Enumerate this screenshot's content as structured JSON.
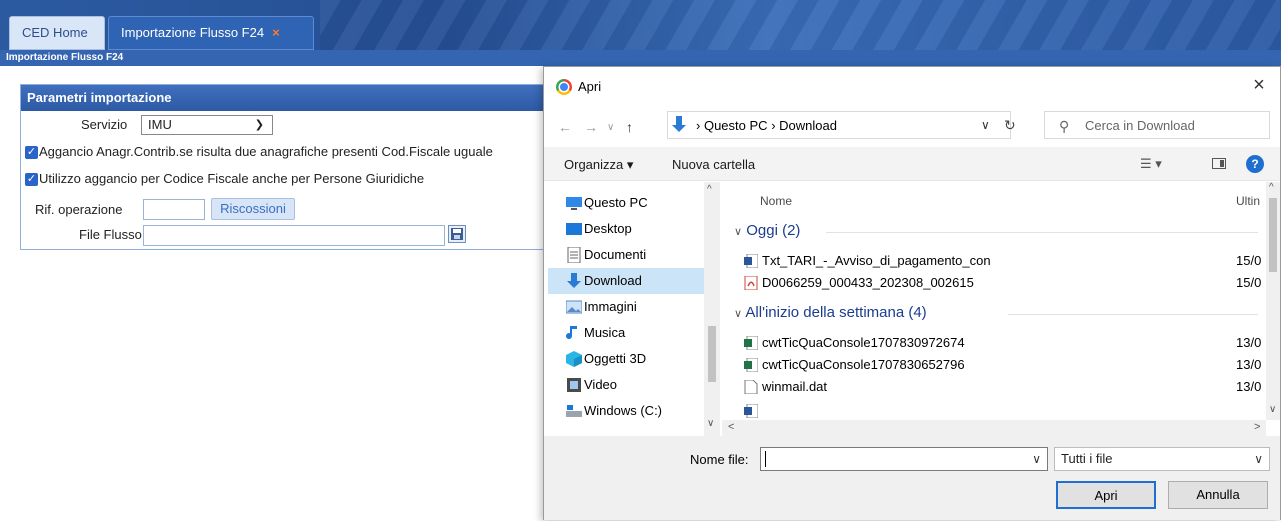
{
  "app": {
    "tabs": [
      {
        "label": "CED Home"
      },
      {
        "label": "Importazione Flusso F24",
        "close": "×"
      }
    ],
    "breadcrumb": "Importazione Flusso F24",
    "panel": {
      "title": "Parametri importazione",
      "servizio_label": "Servizio",
      "servizio_value": "IMU",
      "check1": "Aggancio Anagr.Contrib.se risulta due anagrafiche presenti Cod.Fiscale uguale",
      "check2": "Utilizzo aggancio per Codice Fiscale anche per Persone Giuridiche",
      "rif_label": "Rif. operazione",
      "riscossioni_button": "Riscossioni",
      "file_label": "File Flusso"
    }
  },
  "dialog": {
    "title": "Apri",
    "close": "×",
    "address": {
      "part1": "Questo PC",
      "sep": "›",
      "part2": "Download"
    },
    "search_placeholder": "Cerca in Download",
    "organize": "Organizza ▾",
    "new_folder": "Nuova cartella",
    "nav_items": [
      {
        "label": "Questo PC",
        "icon": "computer-icon"
      },
      {
        "label": "Desktop",
        "icon": "desktop-icon"
      },
      {
        "label": "Documenti",
        "icon": "documents-icon"
      },
      {
        "label": "Download",
        "icon": "download-icon",
        "selected": true
      },
      {
        "label": "Immagini",
        "icon": "pictures-icon"
      },
      {
        "label": "Musica",
        "icon": "music-icon"
      },
      {
        "label": "Oggetti 3D",
        "icon": "objects-3d-icon"
      },
      {
        "label": "Video",
        "icon": "video-icon"
      },
      {
        "label": "Windows (C:)",
        "icon": "drive-icon"
      }
    ],
    "columns": {
      "name": "Nome",
      "date": "Ultin"
    },
    "groups": [
      {
        "label": "Oggi (2)",
        "files": [
          {
            "name": "Txt_TARI_-_Avviso_di_pagamento_con",
            "date": "15/0.",
            "icon": "word-file-icon"
          },
          {
            "name": "D0066259_000433_202308_002615",
            "date": "15/0.",
            "icon": "pdf-file-icon"
          }
        ]
      },
      {
        "label": "All'inizio della settimana (4)",
        "files": [
          {
            "name": "cwtTicQuaConsole1707830972674",
            "date": "13/0.",
            "icon": "excel-file-icon"
          },
          {
            "name": "cwtTicQuaConsole1707830652796",
            "date": "13/0.",
            "icon": "excel-file-icon"
          },
          {
            "name": "winmail.dat",
            "date": "13/0.",
            "icon": "generic-file-icon"
          }
        ]
      }
    ],
    "filename_label": "Nome file:",
    "filename_value": "",
    "filetype": "Tutti i file",
    "open_button": "Apri",
    "cancel_button": "Annulla"
  }
}
